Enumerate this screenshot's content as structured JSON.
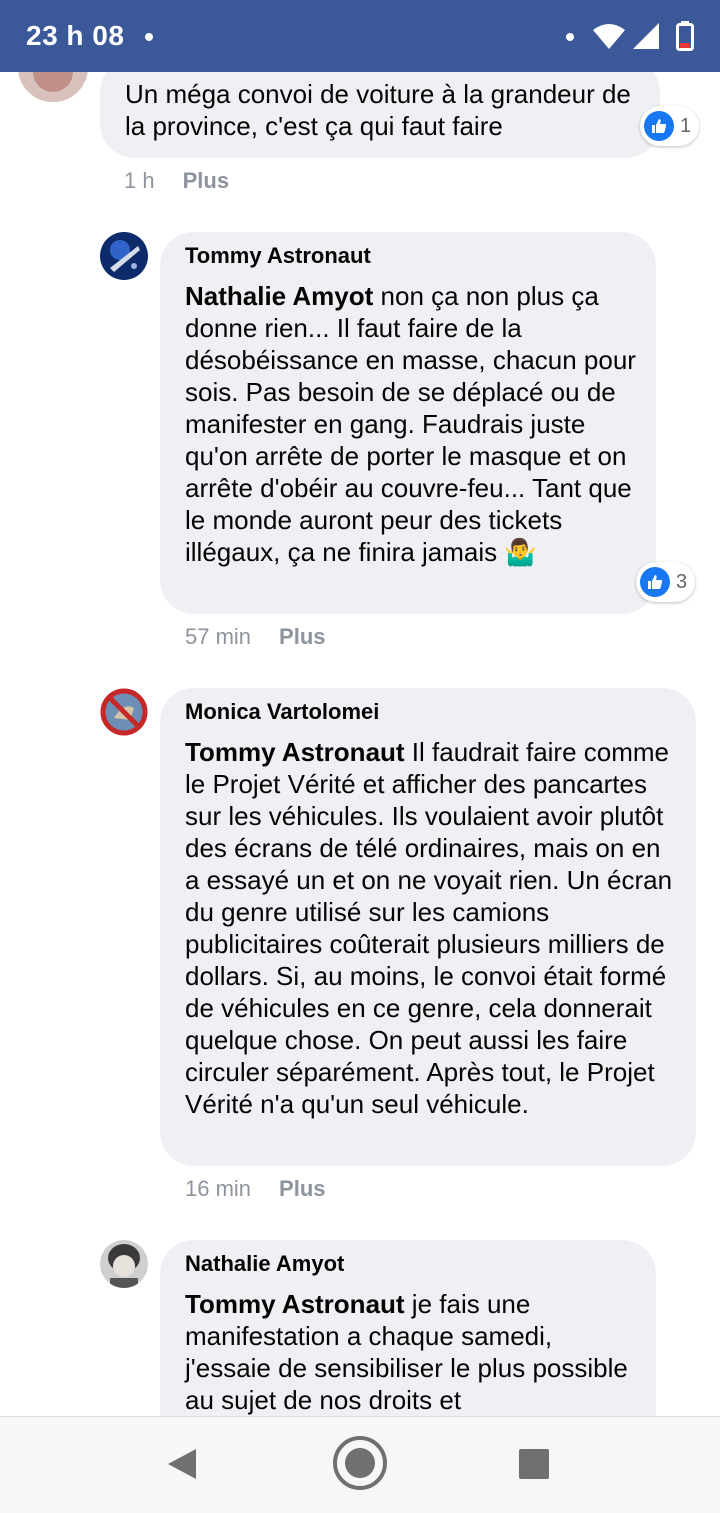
{
  "status_bar": {
    "time": "23 h 08"
  },
  "comments": [
    {
      "text": "Un méga convoi de voiture à la grandeur de la province, c'est ça qui faut faire",
      "reactions": "1",
      "time": "1 h",
      "plus": "Plus"
    },
    {
      "author": "Tommy Astronaut",
      "mention": "Nathalie Amyot",
      "text": " non ça non plus ça donne rien... Il faut faire de la désobéissance en masse, chacun pour sois. Pas besoin de se déplacé ou de manifester en gang. Faudrais juste qu'on arrête de porter le masque et on arrête d'obéir au couvre-feu... Tant que le monde auront peur des tickets illégaux, ça ne finira jamais 🤷‍♂️",
      "reactions": "3",
      "time": "57 min",
      "plus": "Plus"
    },
    {
      "author": "Monica Vartolomei",
      "mention": "Tommy Astronaut",
      "text": " Il faudrait faire comme le Projet Vérité et afficher des pancartes sur les véhicules. Ils voulaient avoir plutôt des écrans de télé ordinaires, mais on en a essayé un et on ne voyait rien. Un écran du genre utilisé sur les camions publicitaires coûterait plusieurs milliers de dollars. Si, au moins, le convoi était formé de véhicules en ce genre, cela donnerait quelque chose. On peut aussi les faire circuler séparément. Après tout, le Projet Vérité n'a qu'un seul véhicule.",
      "time": "16 min",
      "plus": "Plus"
    },
    {
      "author": "Nathalie Amyot",
      "mention": "Tommy Astronaut",
      "text": " je fais une manifestation a chaque samedi, j'essaie de sensibiliser le plus possible au sujet de nos droits et"
    }
  ],
  "colors": {
    "status_bar": "#3b5998",
    "bubble": "#eef0f3",
    "like": "#1877f2",
    "meta": "#8d949e"
  },
  "icons": {
    "back": "back-triangle-icon",
    "home": "home-circle-icon",
    "recent": "recent-square-icon"
  }
}
